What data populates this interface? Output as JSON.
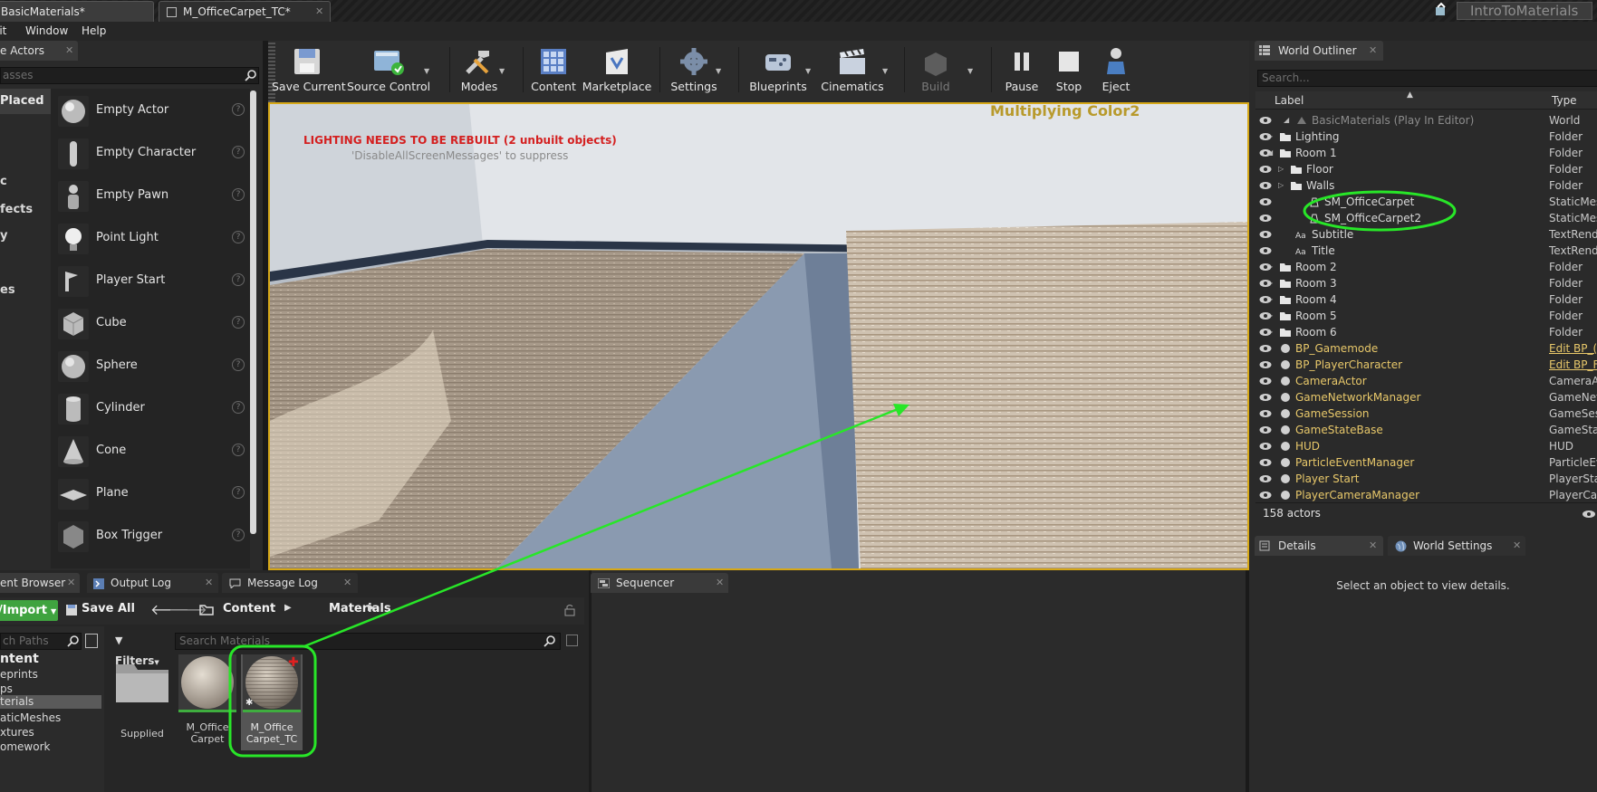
{
  "title_tabs": {
    "level": "BasicMaterials*",
    "material": "M_OfficeCarpet_TC*",
    "project": "IntroToMaterials"
  },
  "menu": [
    "lit",
    "Window",
    "Help"
  ],
  "place_actors": {
    "tab": "e Actors",
    "search_placeholder": "asses",
    "categories": [
      "Placed",
      "c",
      "fects",
      "y",
      "es"
    ],
    "items": [
      "Empty Actor",
      "Empty Character",
      "Empty Pawn",
      "Point Light",
      "Player Start",
      "Cube",
      "Sphere",
      "Cylinder",
      "Cone",
      "Plane",
      "Box Trigger"
    ]
  },
  "toolbar": {
    "save_current": "Save Current",
    "source_control": "Source Control",
    "modes": "Modes",
    "content": "Content",
    "marketplace": "Marketplace",
    "settings": "Settings",
    "blueprints": "Blueprints",
    "cinematics": "Cinematics",
    "build": "Build",
    "pause": "Pause",
    "stop": "Stop",
    "eject": "Eject"
  },
  "viewport": {
    "warning": "LIGHTING NEEDS TO BE REBUILT (2 unbuilt objects)",
    "suppress": "'DisableAllScreenMessages' to suppress",
    "title_text": "Multiplying Color2"
  },
  "outliner": {
    "tab": "World Outliner",
    "search_placeholder": "Search...",
    "col_label": "Label",
    "col_type": "Type",
    "rows": [
      {
        "label": "BasicMaterials (Play In Editor)",
        "type": "World"
      },
      {
        "label": "Lighting",
        "type": "Folder"
      },
      {
        "label": "Room 1",
        "type": "Folder"
      },
      {
        "label": "Floor",
        "type": "Folder"
      },
      {
        "label": "Walls",
        "type": "Folder"
      },
      {
        "label": "SM_OfficeCarpet",
        "type": "StaticMes"
      },
      {
        "label": "SM_OfficeCarpet2",
        "type": "StaticMes"
      },
      {
        "label": "Subtitle",
        "type": "TextRend"
      },
      {
        "label": "Title",
        "type": "TextRend"
      },
      {
        "label": "Room 2",
        "type": "Folder"
      },
      {
        "label": "Room 3",
        "type": "Folder"
      },
      {
        "label": "Room 4",
        "type": "Folder"
      },
      {
        "label": "Room 5",
        "type": "Folder"
      },
      {
        "label": "Room 6",
        "type": "Folder"
      },
      {
        "label": "BP_Gamemode",
        "type": "Edit BP_("
      },
      {
        "label": "BP_PlayerCharacter",
        "type": "Edit BP_F"
      },
      {
        "label": "CameraActor",
        "type": "CameraAc"
      },
      {
        "label": "GameNetworkManager",
        "type": "GameNetv"
      },
      {
        "label": "GameSession",
        "type": "GameSess"
      },
      {
        "label": "GameStateBase",
        "type": "GameStat"
      },
      {
        "label": "HUD",
        "type": "HUD"
      },
      {
        "label": "ParticleEventManager",
        "type": "ParticleEv"
      },
      {
        "label": "Player Start",
        "type": "PlayerSta"
      },
      {
        "label": "PlayerCameraManager",
        "type": "PlayerCar"
      }
    ],
    "actor_count": "158 actors"
  },
  "details": {
    "tab": "Details",
    "world_settings_tab": "World Settings",
    "empty_text": "Select an object to view details."
  },
  "bottom_tabs": {
    "content_browser": "ent Browser",
    "output_log": "Output Log",
    "message_log": "Message Log",
    "sequencer": "Sequencer"
  },
  "content_browser": {
    "import": "/Import",
    "save_all": "Save All",
    "path": [
      "Content",
      "Materials"
    ],
    "paths_placeholder": "ch Paths",
    "filters": "Filters",
    "search_placeholder": "Search Materials",
    "tree": [
      "ntent",
      "eprints",
      "ps",
      "terials",
      "aticMeshes",
      "xtures",
      "omework"
    ],
    "assets": [
      {
        "line1": "Supplied",
        "line2": ""
      },
      {
        "line1": "M_Office",
        "line2": "Carpet"
      },
      {
        "line1": "M_Office",
        "line2": "Carpet_TC"
      }
    ]
  },
  "colors": {
    "highlight_green": "#28e628",
    "editor_bg": "#303030",
    "warning_red": "#d42020",
    "link_yellow": "#e8c86a"
  }
}
